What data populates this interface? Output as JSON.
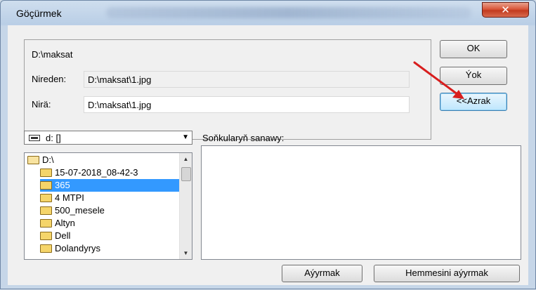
{
  "window": {
    "title": "Göçürmek",
    "close_label": "✕"
  },
  "info": {
    "path": "D:\\maksat",
    "from_label": "Nireden:",
    "from_value": "D:\\maksat\\1.jpg",
    "to_label": "Nirä:",
    "to_value": "D:\\maksat\\1.jpg"
  },
  "buttons": {
    "ok": "OK",
    "cancel": "Ýok",
    "back": "<<Azrak",
    "remove": "Aýyrmak",
    "remove_all": "Hemmesini aýyrmak"
  },
  "drive": {
    "label": "d: []"
  },
  "tree": {
    "items": [
      {
        "label": "D:\\",
        "type": "open-folder",
        "selected": false
      },
      {
        "label": "15-07-2018_08-42-3",
        "type": "folder",
        "selected": false
      },
      {
        "label": "365",
        "type": "folder",
        "selected": true
      },
      {
        "label": "4 MTPI",
        "type": "folder",
        "selected": false
      },
      {
        "label": "500_mesele",
        "type": "folder",
        "selected": false
      },
      {
        "label": "Altyn",
        "type": "folder",
        "selected": false
      },
      {
        "label": "Dell",
        "type": "folder",
        "selected": false
      },
      {
        "label": "Dolandyrys",
        "type": "folder",
        "selected": false
      }
    ]
  },
  "results": {
    "label": "Soňkularyň sanawy:"
  },
  "colors": {
    "selection": "#3399ff",
    "annotation_arrow": "#d81e1e"
  }
}
